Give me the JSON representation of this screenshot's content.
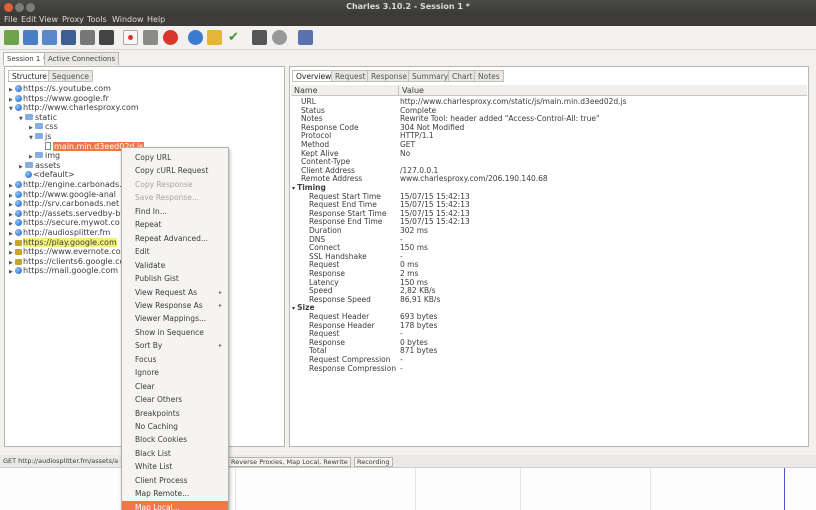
{
  "window": {
    "title": "Charles 3.10.2 - Session 1 *"
  },
  "menubar": [
    "File",
    "Edit",
    "View",
    "Proxy",
    "Tools",
    "Window",
    "Help"
  ],
  "toolbar": [
    "new-session-icon",
    "open-icon",
    "clear-icon",
    "save-icon",
    "trash-icon",
    "find-icon",
    "record-icon",
    "throttle-icon",
    "breakpoints-icon",
    "refresh-icon",
    "edit-icon",
    "validate-icon",
    "tools-icon",
    "settings-icon",
    "cart-icon"
  ],
  "session_tabs": [
    "Session 1 *",
    "Active Connections"
  ],
  "left_tabs": [
    "Structure",
    "Sequence"
  ],
  "tree": [
    {
      "label": "https://s.youtube.com",
      "indent": 0,
      "icon": "globe",
      "tw": "▶"
    },
    {
      "label": "https://www.google.fr",
      "indent": 0,
      "icon": "globe",
      "tw": "▶"
    },
    {
      "label": "http://www.charlesproxy.com",
      "indent": 0,
      "icon": "globe",
      "tw": "▼"
    },
    {
      "label": "static",
      "indent": 1,
      "icon": "folder",
      "tw": "▼"
    },
    {
      "label": "css",
      "indent": 2,
      "icon": "folder",
      "tw": "▶"
    },
    {
      "label": "js",
      "indent": 2,
      "icon": "folder",
      "tw": "▼"
    },
    {
      "label": "main.min.d3eed02d.js",
      "indent": 3,
      "icon": "file",
      "tw": "",
      "selected": true
    },
    {
      "label": "img",
      "indent": 2,
      "icon": "folder",
      "tw": "▶"
    },
    {
      "label": "assets",
      "indent": 1,
      "icon": "folder",
      "tw": "▶"
    },
    {
      "label": "<default>",
      "indent": 1,
      "icon": "globe",
      "tw": ""
    },
    {
      "label": "http://engine.carbonads.",
      "indent": 0,
      "icon": "globe",
      "tw": "▶"
    },
    {
      "label": "http://www.google-anal",
      "indent": 0,
      "icon": "globe",
      "tw": "▶"
    },
    {
      "label": "http://srv.carbonads.net",
      "indent": 0,
      "icon": "globe",
      "tw": "▶"
    },
    {
      "label": "http://assets.servedby-bu",
      "indent": 0,
      "icon": "globe",
      "tw": "▶"
    },
    {
      "label": "https://secure.mywot.co",
      "indent": 0,
      "icon": "globe",
      "tw": "▶"
    },
    {
      "label": "http://audiosplitter.fm",
      "indent": 0,
      "icon": "globe",
      "tw": "▶"
    },
    {
      "label": "https://play.google.com",
      "indent": 0,
      "icon": "lock",
      "tw": "▶",
      "highlight": true
    },
    {
      "label": "https://www.evernote.co",
      "indent": 0,
      "icon": "lock",
      "tw": "▶"
    },
    {
      "label": "https://clients6.google.co",
      "indent": 0,
      "icon": "lock",
      "tw": "▶"
    },
    {
      "label": "https://mail.google.com",
      "indent": 0,
      "icon": "globe",
      "tw": "▶"
    }
  ],
  "context_menu": [
    {
      "label": "Copy URL"
    },
    {
      "label": "Copy cURL Request"
    },
    {
      "label": "Copy Response",
      "disabled": true
    },
    {
      "label": "Save Response...",
      "disabled": true
    },
    {
      "label": "Find In..."
    },
    {
      "label": "Repeat"
    },
    {
      "label": "Repeat Advanced..."
    },
    {
      "label": "Edit"
    },
    {
      "label": "Validate"
    },
    {
      "label": "Publish Gist"
    },
    {
      "label": "View Request As",
      "submenu": true
    },
    {
      "label": "View Response As",
      "submenu": true
    },
    {
      "label": "Viewer Mappings..."
    },
    {
      "label": "Show in Sequence"
    },
    {
      "label": "Sort By",
      "submenu": true
    },
    {
      "label": "Focus"
    },
    {
      "label": "Ignore"
    },
    {
      "label": "Clear"
    },
    {
      "label": "Clear Others"
    },
    {
      "label": "Breakpoints"
    },
    {
      "label": "No Caching"
    },
    {
      "label": "Block Cookies"
    },
    {
      "label": "Black List"
    },
    {
      "label": "White List"
    },
    {
      "label": "Client Process"
    },
    {
      "label": "Map Remote..."
    },
    {
      "label": "Map Local...",
      "selected": true
    }
  ],
  "right_tabs": [
    "Overview",
    "Request",
    "Response",
    "Summary",
    "Chart",
    "Notes"
  ],
  "table": {
    "col_name": "Name",
    "col_value": "Value",
    "rows": [
      {
        "name": "URL",
        "value": "http://www.charlesproxy.com/static/js/main.min.d3eed02d.js",
        "lvl": 1
      },
      {
        "name": "Status",
        "value": "Complete",
        "lvl": 1
      },
      {
        "name": "Notes",
        "value": "Rewrite Tool: header added \"Access-Control-All: true\"",
        "lvl": 1
      },
      {
        "name": "Response Code",
        "value": "304 Not Modified",
        "lvl": 1
      },
      {
        "name": "Protocol",
        "value": "HTTP/1.1",
        "lvl": 1
      },
      {
        "name": "Method",
        "value": "GET",
        "lvl": 1
      },
      {
        "name": "Kept Alive",
        "value": "No",
        "lvl": 1
      },
      {
        "name": "Content-Type",
        "value": "",
        "lvl": 1
      },
      {
        "name": "Client Address",
        "value": "/127.0.0.1",
        "lvl": 1
      },
      {
        "name": "Remote Address",
        "value": "www.charlesproxy.com/206.190.140.68",
        "lvl": 1
      },
      {
        "name": "Timing",
        "value": "",
        "lvl": 0,
        "group": true
      },
      {
        "name": "Request Start Time",
        "value": "15/07/15 15:42:13",
        "lvl": 2
      },
      {
        "name": "Request End Time",
        "value": "15/07/15 15:42:13",
        "lvl": 2
      },
      {
        "name": "Response Start Time",
        "value": "15/07/15 15:42:13",
        "lvl": 2
      },
      {
        "name": "Response End Time",
        "value": "15/07/15 15:42:13",
        "lvl": 2
      },
      {
        "name": "Duration",
        "value": "302 ms",
        "lvl": 2
      },
      {
        "name": "DNS",
        "value": "-",
        "lvl": 2
      },
      {
        "name": "Connect",
        "value": "150 ms",
        "lvl": 2
      },
      {
        "name": "SSL Handshake",
        "value": "-",
        "lvl": 2
      },
      {
        "name": "Request",
        "value": "0 ms",
        "lvl": 2
      },
      {
        "name": "Response",
        "value": "2 ms",
        "lvl": 2
      },
      {
        "name": "Latency",
        "value": "150 ms",
        "lvl": 2
      },
      {
        "name": "Speed",
        "value": "2,82 KB/s",
        "lvl": 2
      },
      {
        "name": "Response Speed",
        "value": "86,91 KB/s",
        "lvl": 2
      },
      {
        "name": "Size",
        "value": "",
        "lvl": 0,
        "group": true
      },
      {
        "name": "Request Header",
        "value": "693 bytes",
        "lvl": 2
      },
      {
        "name": "Response Header",
        "value": "178 bytes",
        "lvl": 2
      },
      {
        "name": "Request",
        "value": "-",
        "lvl": 2
      },
      {
        "name": "Response",
        "value": "0 bytes",
        "lvl": 2
      },
      {
        "name": "Total",
        "value": "871 bytes",
        "lvl": 2
      },
      {
        "name": "Request Compression",
        "value": "-",
        "lvl": 2
      },
      {
        "name": "Response Compression",
        "value": "-",
        "lvl": 2
      }
    ]
  },
  "status": {
    "text": "GET http://audiosplitter.fm/assets/a",
    "tools": "Reverse Proxies, Map Local, Rewrite",
    "recording": "Recording"
  }
}
